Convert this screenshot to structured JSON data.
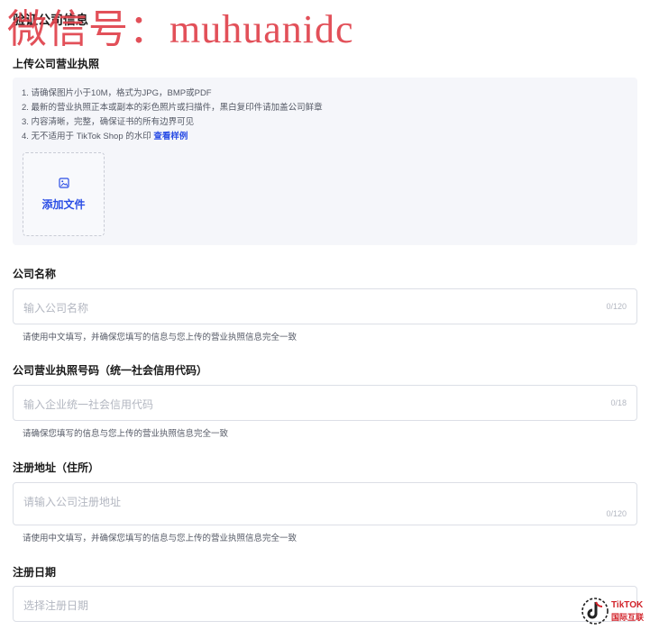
{
  "watermark": "微信号：muhuanidc",
  "page_title": "验证公司信息",
  "upload": {
    "heading": "上传公司营业执照",
    "rules": [
      "1. 请确保图片小于10M，格式为JPG，BMP或PDF",
      "2. 最新的营业执照正本或副本的彩色照片或扫描件，黑白复印件请加盖公司鲜章",
      "3. 内容清晰，完整，确保证书的所有边界可见",
      "4. 无不适用于 TikTok Shop 的水印 "
    ],
    "sample_link": "查看样例",
    "add_file_label": "添加文件"
  },
  "company_name": {
    "label": "公司名称",
    "placeholder": "输入公司名称",
    "counter": "0/120",
    "hint": "请使用中文填写，并确保您填写的信息与您上传的营业执照信息完全一致"
  },
  "license_number": {
    "label": "公司营业执照号码（统一社会信用代码）",
    "placeholder": "输入企业统一社会信用代码",
    "counter": "0/18",
    "hint": "请确保您填写的信息与您上传的营业执照信息完全一致"
  },
  "address": {
    "label": "注册地址（住所）",
    "placeholder": "请输入公司注册地址",
    "counter": "0/120",
    "hint": "请使用中文填写，并确保您填写的信息与您上传的营业执照信息完全一致"
  },
  "reg_date": {
    "label": "注册日期",
    "placeholder": "选择注册日期"
  },
  "logo": {
    "line1": "TikTOK",
    "line2": "国际互联"
  },
  "colors": {
    "accent": "#2b4ee5",
    "watermark": "#e0414b",
    "logo": "#d2232a",
    "panel_bg": "#f5f6fa"
  }
}
